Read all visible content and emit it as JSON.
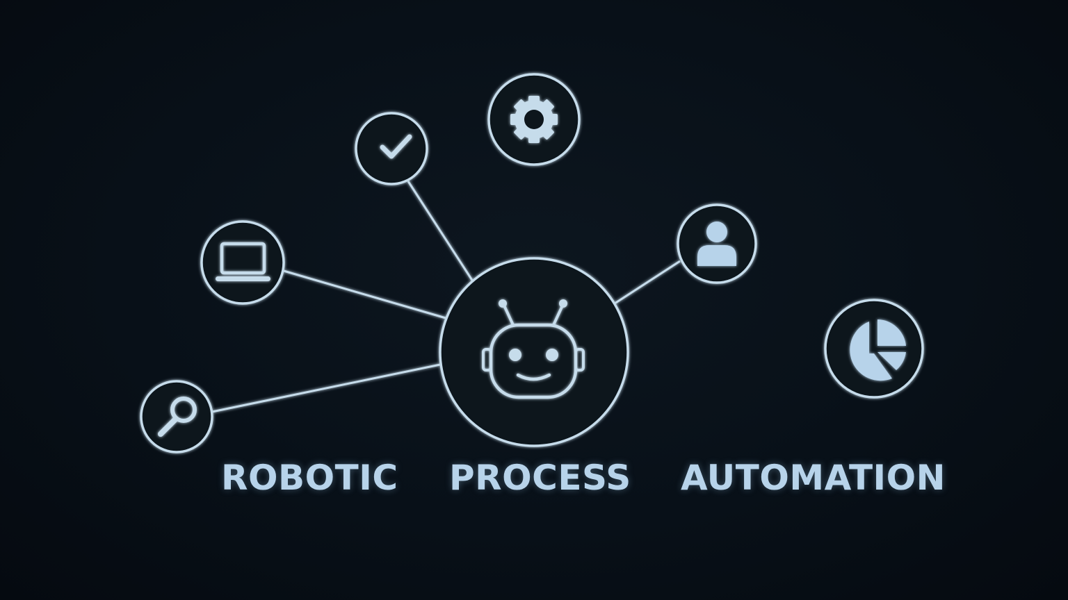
{
  "title_words": [
    "ROBOTIC",
    "PROCESS",
    "AUTOMATION"
  ],
  "colors": {
    "background": "#070d14",
    "line": "#c6dceb",
    "icon_fill": "#b7d3ea",
    "label": "#b7d3ea"
  },
  "hub": {
    "icon": "robot-icon"
  },
  "satellites": [
    {
      "icon": "checkmark-icon"
    },
    {
      "icon": "gear-icon"
    },
    {
      "icon": "laptop-icon"
    },
    {
      "icon": "user-icon"
    },
    {
      "icon": "pie-chart-icon"
    },
    {
      "icon": "magnifier-icon"
    }
  ]
}
